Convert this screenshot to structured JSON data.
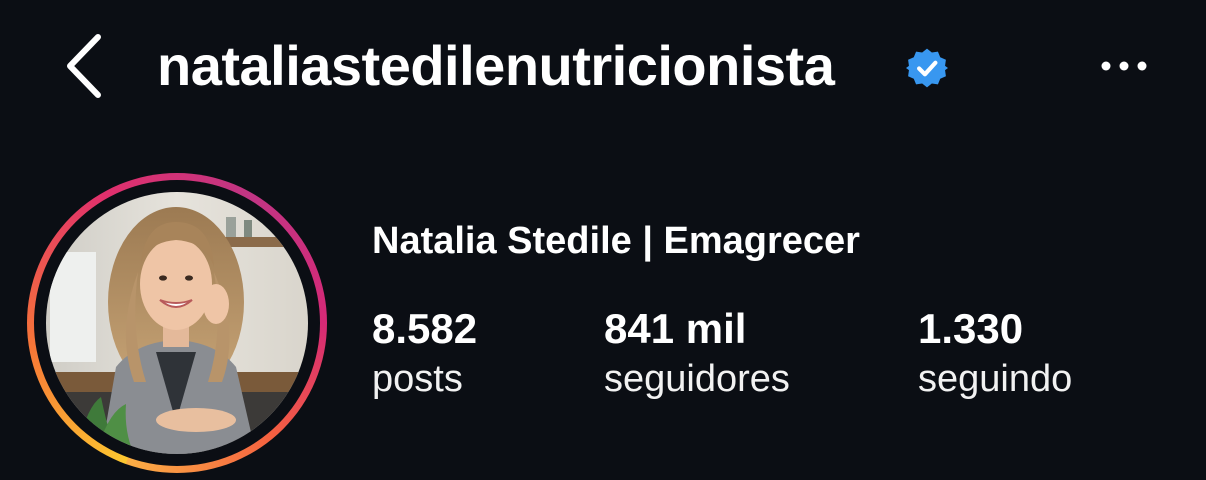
{
  "header": {
    "back_icon": "chevron-left-icon",
    "username": "nataliastedilenutricionista",
    "verified_icon": "verified-badge-icon",
    "verified_color": "#3897f0",
    "more_icon": "ellipsis-icon"
  },
  "profile": {
    "avatar_ring_colors": [
      "#fdc830",
      "#f77737",
      "#e1306c",
      "#c13584"
    ],
    "display_name": "Natalia Stedile | Emagrecer",
    "stats": {
      "posts": {
        "value": "8.582",
        "label": "posts"
      },
      "followers": {
        "value": "841 mil",
        "label": "seguidores"
      },
      "following": {
        "value": "1.330",
        "label": "seguindo"
      }
    }
  }
}
